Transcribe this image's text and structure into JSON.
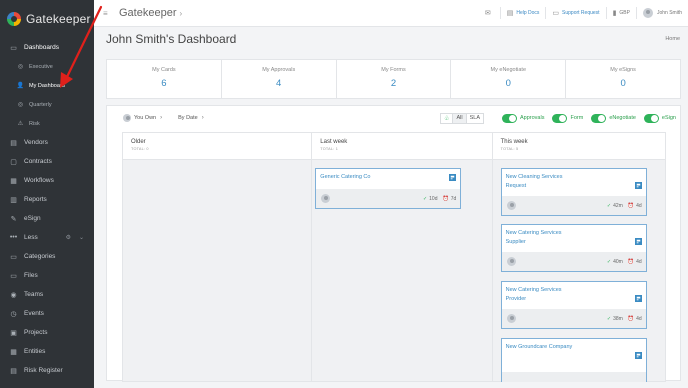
{
  "brand": {
    "name": "Gatekeeper"
  },
  "sidebar": {
    "items": [
      {
        "label": "Dashboards",
        "icon": "monitor-icon"
      },
      {
        "label": "Executive",
        "icon": "circle-icon"
      },
      {
        "label": "My Dashboard",
        "icon": "user-icon"
      },
      {
        "label": "Quarterly",
        "icon": "circle-icon"
      },
      {
        "label": "Risk",
        "icon": "warning-icon"
      },
      {
        "label": "Vendors",
        "icon": "vendor-icon"
      },
      {
        "label": "Contracts",
        "icon": "contract-icon"
      },
      {
        "label": "Workflows",
        "icon": "workflow-icon"
      },
      {
        "label": "Reports",
        "icon": "report-icon"
      },
      {
        "label": "eSign",
        "icon": "esign-icon"
      },
      {
        "label": "Less",
        "icon": "dots-icon"
      },
      {
        "label": "Categories",
        "icon": "folder-icon"
      },
      {
        "label": "Files",
        "icon": "file-icon"
      },
      {
        "label": "Teams",
        "icon": "team-icon"
      },
      {
        "label": "Events",
        "icon": "event-icon"
      },
      {
        "label": "Projects",
        "icon": "project-icon"
      },
      {
        "label": "Entities",
        "icon": "entity-icon"
      },
      {
        "label": "Risk Register",
        "icon": "register-icon"
      }
    ]
  },
  "topbar": {
    "title": "Gatekeeper",
    "help_docs": "Help Docs",
    "support_request": "Support Request",
    "currency": "GBP",
    "user_name": "John Smith"
  },
  "page": {
    "title": "John Smith's Dashboard",
    "breadcrumb": "Home"
  },
  "stats": [
    {
      "label": "My Cards",
      "value": "6"
    },
    {
      "label": "My Approvals",
      "value": "4"
    },
    {
      "label": "My Forms",
      "value": "2"
    },
    {
      "label": "My eNegotiate",
      "value": "0"
    },
    {
      "label": "My eSigns",
      "value": "0"
    }
  ],
  "toolbar": {
    "owner": "You Own",
    "sort": "By Date",
    "filter_all": "All",
    "filter_sla": "SLA",
    "toggles": [
      "Approvals",
      "Form",
      "eNegotiate",
      "eSign"
    ]
  },
  "columns": [
    {
      "title": "Older",
      "subtitle": "TOTAL: 0"
    },
    {
      "title": "Last week",
      "subtitle": "TOTAL: 1"
    },
    {
      "title": "This week",
      "subtitle": "TOTAL: 5"
    }
  ],
  "cards": {
    "c1": {
      "title": "Generic Catering Co",
      "m1": "10d",
      "m2": "7d"
    },
    "c2": {
      "title": "New Cleaning Services Request",
      "m1": "42m",
      "m2": "4d"
    },
    "c3": {
      "title": "New Catering Services Supplier",
      "m1": "40m",
      "m2": "4d"
    },
    "c4": {
      "title": "New Catering Services Provider",
      "m1": "38m",
      "m2": "4d"
    },
    "c5": {
      "title": "New Groundcare Company",
      "m1": "",
      "m2": ""
    }
  },
  "colors": {
    "accent": "#3a8bc2",
    "green": "#2fb35a",
    "sidebar": "#2f3337",
    "arrow": "#e0201b"
  }
}
